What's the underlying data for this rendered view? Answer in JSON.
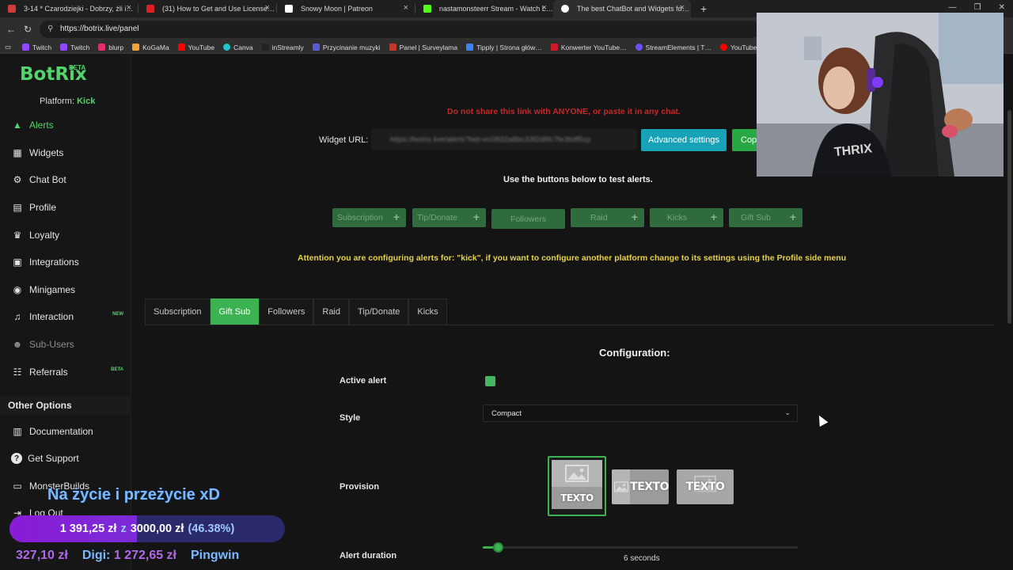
{
  "browser": {
    "tabs": [
      {
        "title": "3-14 * Czarodziejki - Dobrzy, źli i…",
        "favicon_color": "#d13b3b",
        "active": false
      },
      {
        "title": "(31) How to Get and Use License…",
        "favicon_color": "#e02020",
        "active": false
      },
      {
        "title": "Snowy Moon | Patreon",
        "favicon_color": "#ffffff",
        "active": false
      },
      {
        "title": "nastamonsteerr Stream - Watch L…",
        "favicon_color": "#53fc18",
        "active": false
      },
      {
        "title": "The best ChatBot and Widgets fo…",
        "favicon_color": "#ffffff",
        "active": true
      }
    ],
    "close_glyph": "×",
    "new_tab": "+",
    "window_buttons": [
      "—",
      "❐",
      "✕"
    ],
    "nav": {
      "back": "←",
      "reload": "↻"
    },
    "url": "https://botrix.live/panel",
    "bookmarks": [
      {
        "label": "Twitch",
        "color": "#9146ff"
      },
      {
        "label": "Twitch",
        "color": "#9146ff"
      },
      {
        "label": "blurp",
        "color": "#e0306a"
      },
      {
        "label": "KoGaMa",
        "color": "#f2a33a"
      },
      {
        "label": "YouTube",
        "color": "#ff0000"
      },
      {
        "label": "Canva",
        "color": "#20c4cb"
      },
      {
        "label": "inStreamly",
        "color": "#222222"
      },
      {
        "label": "Przycinanie muzyki",
        "color": "#5b5bd6"
      },
      {
        "label": "Panel | Surveylama",
        "color": "#c0392b"
      },
      {
        "label": "Tipply | Strona głów…",
        "color": "#3b82f6"
      },
      {
        "label": "Konwerter YouTube…",
        "color": "#d11a2a"
      },
      {
        "label": "StreamElements | T…",
        "color": "#6b4fff"
      },
      {
        "label": "YouTube Music",
        "color": "#ff0000"
      }
    ]
  },
  "sidebar": {
    "logo": "BotRix",
    "logo_badge": "BETA",
    "platform_label": "Platform:",
    "platform_value": "Kick",
    "items": [
      {
        "label": "Alerts",
        "icon": "warning-icon",
        "glyph": "▲",
        "active": true
      },
      {
        "label": "Widgets",
        "icon": "widgets-icon",
        "glyph": "▦"
      },
      {
        "label": "Chat Bot",
        "icon": "robot-icon",
        "glyph": "⚙"
      },
      {
        "label": "Profile",
        "icon": "profile-icon",
        "glyph": "▤"
      },
      {
        "label": "Loyalty",
        "icon": "trophy-icon",
        "glyph": "♛"
      },
      {
        "label": "Integrations",
        "icon": "integrations-icon",
        "glyph": "▣"
      },
      {
        "label": "Minigames",
        "icon": "gamepad-icon",
        "glyph": "◉"
      },
      {
        "label": "Interaction",
        "icon": "music-icon",
        "glyph": "♫",
        "badge": "NEW"
      },
      {
        "label": "Sub-Users",
        "icon": "users-icon",
        "glyph": "☻",
        "dim": true
      },
      {
        "label": "Referrals",
        "icon": "referrals-icon",
        "glyph": "☷",
        "badge": "BETA"
      }
    ],
    "other_options_title": "Other Options",
    "other_items": [
      {
        "label": "Documentation",
        "icon": "document-icon",
        "glyph": "▥"
      },
      {
        "label": "Get Support",
        "icon": "help-icon",
        "glyph": "?"
      },
      {
        "label": "MonsterBuilds",
        "icon": "monitor-icon",
        "glyph": "▭"
      },
      {
        "label": "Log Out",
        "icon": "logout-icon",
        "glyph": "⇥"
      }
    ]
  },
  "main": {
    "warning": "Do not share this link with ANYONE, or paste it in any chat.",
    "widget_url_label": "Widget URL:",
    "widget_url_value": "https://botrix.live/alerts?bid=ec0832a8bc33f2d8fc7fe3bdf5cp",
    "advanced_settings": "Advanced settings",
    "copy_label": "Copy",
    "test_note": "Use the buttons below to test alerts.",
    "test_buttons": [
      {
        "label": "Subscription",
        "plus": true
      },
      {
        "label": "Tip/Donate",
        "plus": true
      },
      {
        "label": "Followers",
        "plus": false
      },
      {
        "label": "Raid",
        "plus": true
      },
      {
        "label": "Kicks",
        "plus": true
      },
      {
        "label": "Gift Sub",
        "plus": true
      }
    ],
    "attention": "Attention you are configuring alerts for: \"kick\", if you want to configure another platform change to its settings using the Profile side menu",
    "tabs": [
      {
        "label": "Subscription"
      },
      {
        "label": "Gift Sub",
        "active": true
      },
      {
        "label": "Followers"
      },
      {
        "label": "Raid"
      },
      {
        "label": "Tip/Donate"
      },
      {
        "label": "Kicks"
      }
    ],
    "config": {
      "title": "Configuration:",
      "active_alert_label": "Active alert",
      "active_alert_checked": true,
      "style_label": "Style",
      "style_value": "Compact",
      "provision_label": "Provision",
      "provision_text": "TEXTO",
      "provision_selected": 0,
      "alert_duration_label": "Alert duration",
      "alert_duration_value": "6 seconds",
      "alert_duration_fraction": 0.04
    }
  },
  "overlay": {
    "title": "Na życie i przeżycie xD",
    "current": "1 391,25 zł",
    "of": "z",
    "goal": "3000,00 zł",
    "percent": "(46.38%)",
    "progress": 0.4638,
    "ticker": [
      {
        "name": "",
        "amount": "327,10 zł"
      },
      {
        "name": "Digi:",
        "amount": "1 272,65 zł"
      },
      {
        "name": "Pingwin",
        "amount": ""
      }
    ]
  },
  "colors": {
    "accent": "#53d46b",
    "teal": "#17a2b8",
    "warning_red": "#c62828",
    "attention_yellow": "#e6d14a"
  }
}
